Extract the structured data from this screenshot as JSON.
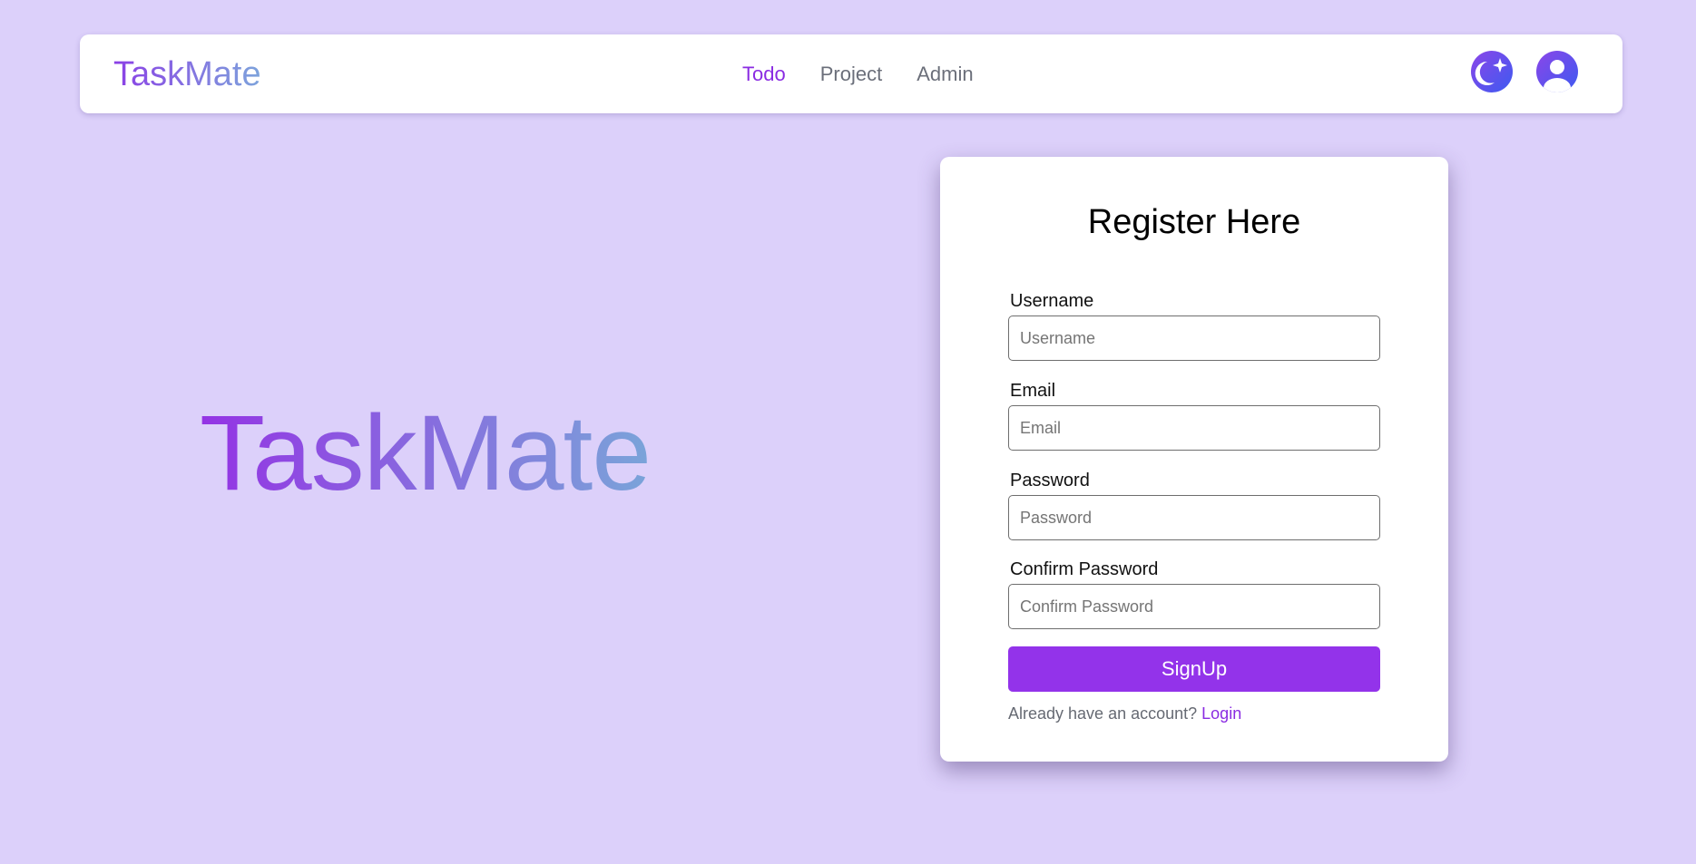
{
  "app": {
    "brand": "TaskMate"
  },
  "nav": {
    "links": [
      {
        "label": "Todo",
        "active": true
      },
      {
        "label": "Project",
        "active": false
      },
      {
        "label": "Admin",
        "active": false
      }
    ],
    "icons": {
      "theme_toggle": "moon-star-icon",
      "profile": "user-avatar-icon"
    }
  },
  "hero": {
    "title": "TaskMate"
  },
  "register": {
    "title": "Register Here",
    "fields": {
      "username": {
        "label": "Username",
        "placeholder": "Username",
        "value": ""
      },
      "email": {
        "label": "Email",
        "placeholder": "Email",
        "value": ""
      },
      "password": {
        "label": "Password",
        "placeholder": "Password",
        "value": ""
      },
      "confirm_password": {
        "label": "Confirm Password",
        "placeholder": "Confirm Password",
        "value": ""
      }
    },
    "submit_label": "SignUp",
    "footer_text": "Already have an account? ",
    "login_link": "Login"
  },
  "colors": {
    "page_background": "#dcd0fa",
    "accent": "#9333ea",
    "active_link": "#8a2be2",
    "icon_gradient_start": "#8b46e8",
    "icon_gradient_end": "#3d5af1",
    "brand_gradient_start": "#8b3fe6",
    "brand_gradient_end": "#7da4dc"
  }
}
